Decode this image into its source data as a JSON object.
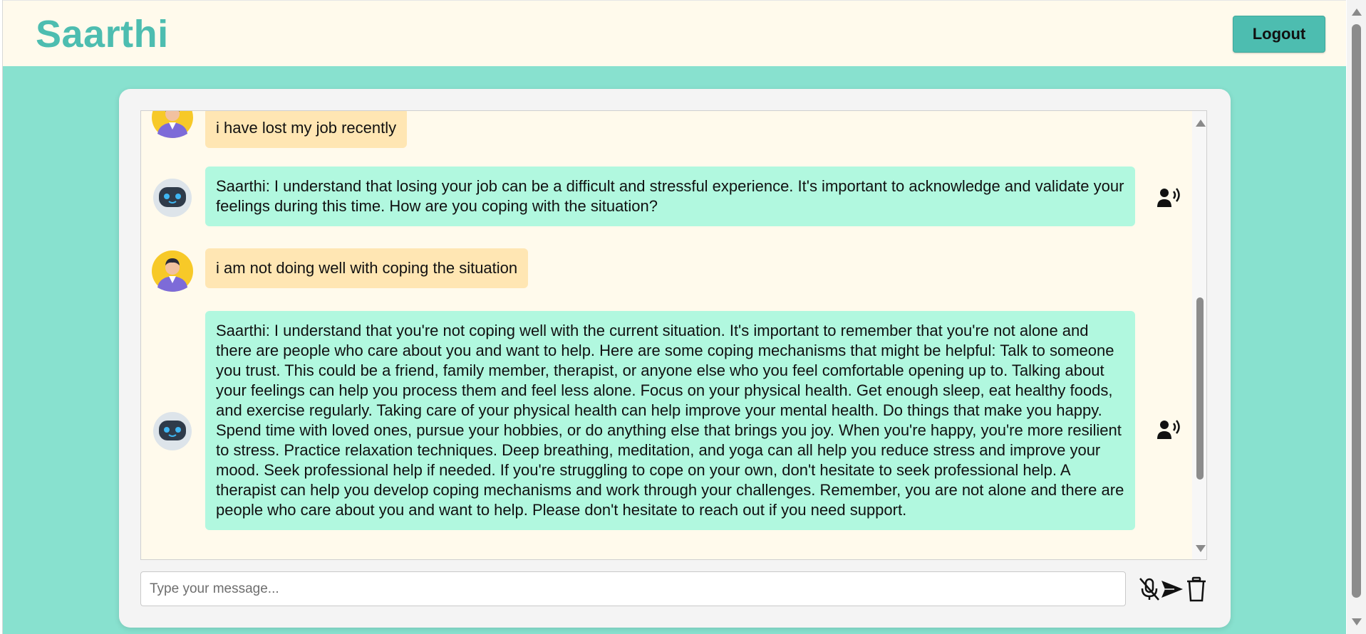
{
  "header": {
    "brand": "Saarthi",
    "logout_label": "Logout"
  },
  "colors": {
    "teal": "#4dbdb0",
    "page_bg": "#88e1cf",
    "user_bubble": "#ffe6b3",
    "bot_bubble": "#b1f8df",
    "chat_bg": "#fffaec"
  },
  "messages": [
    {
      "role": "user",
      "text": "i have lost my job recently"
    },
    {
      "role": "bot",
      "text": "Saarthi: I understand that losing your job can be a difficult and stressful experience. It's important to acknowledge and validate your feelings during this time. How are you coping with the situation?"
    },
    {
      "role": "user",
      "text": "i am not doing well with coping the situation"
    },
    {
      "role": "bot",
      "text": "Saarthi: I understand that you're not coping well with the current situation. It's important to remember that you're not alone and there are people who care about you and want to help. Here are some coping mechanisms that might be helpful: Talk to someone you trust. This could be a friend, family member, therapist, or anyone else who you feel comfortable opening up to. Talking about your feelings can help you process them and feel less alone. Focus on your physical health. Get enough sleep, eat healthy foods, and exercise regularly. Taking care of your physical health can help improve your mental health. Do things that make you happy. Spend time with loved ones, pursue your hobbies, or do anything else that brings you joy. When you're happy, you're more resilient to stress. Practice relaxation techniques. Deep breathing, meditation, and yoga can all help you reduce stress and improve your mood. Seek professional help if needed. If you're struggling to cope on your own, don't hesitate to seek professional help. A therapist can help you develop coping mechanisms and work through your challenges. Remember, you are not alone and there are people who care about you and want to help. Please don't hesitate to reach out if you need support."
    }
  ],
  "composer": {
    "placeholder": "Type your message...",
    "value": ""
  },
  "icons": {
    "mic": "mic-off-icon",
    "send": "send-icon",
    "clear": "trash-icon",
    "speak": "speaker-icon"
  }
}
